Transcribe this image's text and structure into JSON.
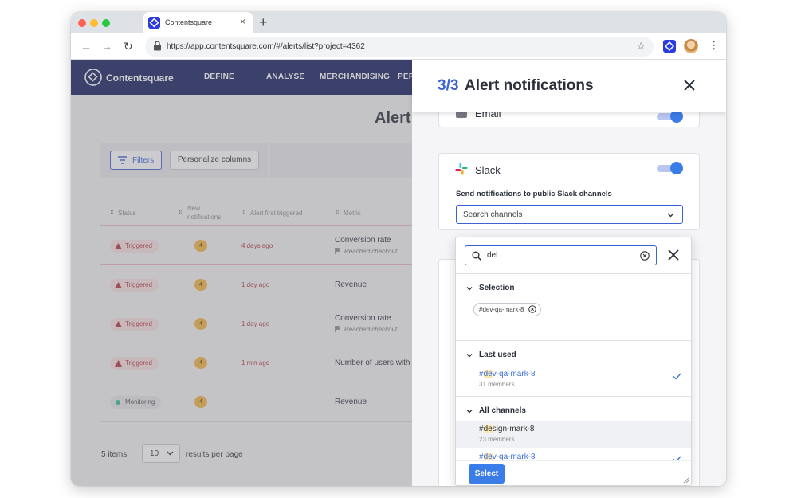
{
  "browser": {
    "tab_title": "Contentsquare",
    "tab_close": "×",
    "new_tab": "+",
    "url": "https://app.contentsquare.com/#/alerts/list?project=4362",
    "back": "←",
    "forward": "→",
    "reload": "↻",
    "star": "☆",
    "menu": "⋮"
  },
  "app": {
    "brand": "Contentsquare",
    "nav": [
      "DEFINE",
      "ANALYSE",
      "MERCHANDISING",
      "PER"
    ],
    "page_title": "Alert",
    "filters_label": "Filters",
    "personalize_label": "Personalize columns",
    "columns": {
      "status": "Status",
      "new_notifications_1": "New",
      "new_notifications_2": "notifications",
      "first_triggered": "Alert first triggered",
      "metric": "Metric"
    },
    "rows": [
      {
        "status": "Triggered",
        "count": "4",
        "time": "4 days ago",
        "metric": "Conversion rate",
        "sub": "Reached checkout"
      },
      {
        "status": "Triggered",
        "count": "4",
        "time": "1 day ago",
        "metric": "Revenue",
        "sub": ""
      },
      {
        "status": "Triggered",
        "count": "4",
        "time": "1 day ago",
        "metric": "Conversion rate",
        "sub": "Reached checkout"
      },
      {
        "status": "Triggered",
        "count": "4",
        "time": "1 min ago",
        "metric": "Number of users with",
        "sub": ""
      },
      {
        "status": "Monitoring",
        "count": "4",
        "time": "",
        "metric": "Revenue",
        "sub": ""
      }
    ],
    "items_count": "5 items",
    "per_page_value": "10",
    "per_page_label": "results per page"
  },
  "panel": {
    "step": "3/3",
    "title": "Alert notifications",
    "email_label": "Email",
    "email_enabled": true,
    "slack_label": "Slack",
    "slack_enabled": true,
    "slack_description": "Send notifications to public Slack channels",
    "slack_search_placeholder": "Search channels"
  },
  "dropdown": {
    "query": "del",
    "sections": {
      "selection": "Selection",
      "last_used": "Last used",
      "all_channels": "All channels"
    },
    "selected_chip": "#dev-qa-mark-8",
    "last_used": [
      {
        "prefix": "#",
        "match": "de",
        "rest": "v-qa-mark-8",
        "members": "31 members",
        "selected": true
      }
    ],
    "all_channels": [
      {
        "prefix": "#",
        "match": "de",
        "rest": "sign-mark-8",
        "members": "23 members",
        "selected": false
      },
      {
        "prefix": "#",
        "match": "de",
        "rest": "v-qa-mark-8",
        "members": "",
        "selected": true
      }
    ],
    "select_button": "Select"
  },
  "colors": {
    "nav_bg": "#171f61",
    "accent": "#3b63d6",
    "triggered": "#b3343f",
    "count_badge": "#f2b443",
    "toggle_on": "#3b7de8"
  }
}
